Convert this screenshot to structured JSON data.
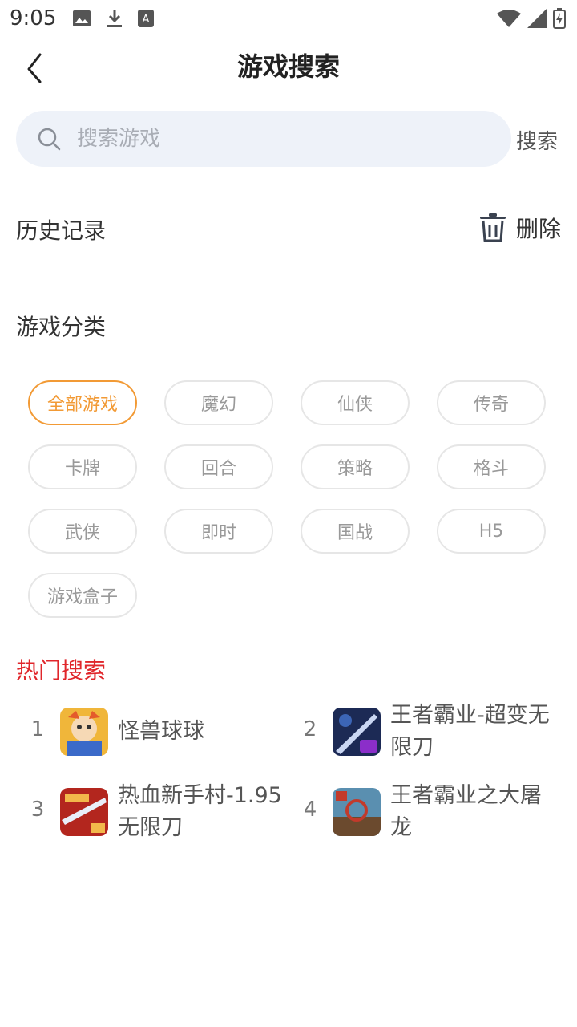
{
  "status_bar": {
    "time": "9:05",
    "left_icons": [
      "image-icon",
      "download-icon",
      "a-badge-icon"
    ],
    "right_icons": [
      "wifi-icon",
      "signal-icon",
      "battery-charging-icon"
    ]
  },
  "nav": {
    "title": "游戏搜索",
    "back_icon": "chevron-left-icon"
  },
  "search": {
    "placeholder": "搜索游戏",
    "value": "",
    "button_label": "搜索"
  },
  "history": {
    "title": "历史记录",
    "delete_label": "删除"
  },
  "categories": {
    "title": "游戏分类",
    "active_color": "#f29a35",
    "items": [
      {
        "label": "全部游戏",
        "active": true
      },
      {
        "label": "魔幻"
      },
      {
        "label": "仙侠"
      },
      {
        "label": "传奇"
      },
      {
        "label": "卡牌"
      },
      {
        "label": "回合"
      },
      {
        "label": "策略"
      },
      {
        "label": "格斗"
      },
      {
        "label": "武侠"
      },
      {
        "label": "即时"
      },
      {
        "label": "国战"
      },
      {
        "label": "H5"
      },
      {
        "label": "游戏盒子"
      }
    ]
  },
  "hot": {
    "title": "热门搜索",
    "title_color": "#e0262b",
    "items": [
      {
        "rank": "1",
        "name": "怪兽球球"
      },
      {
        "rank": "2",
        "name": "王者霸业-超变无限刀"
      },
      {
        "rank": "3",
        "name": "热血新手村-1.95无限刀"
      },
      {
        "rank": "4",
        "name": "王者霸业之大屠龙"
      }
    ]
  }
}
